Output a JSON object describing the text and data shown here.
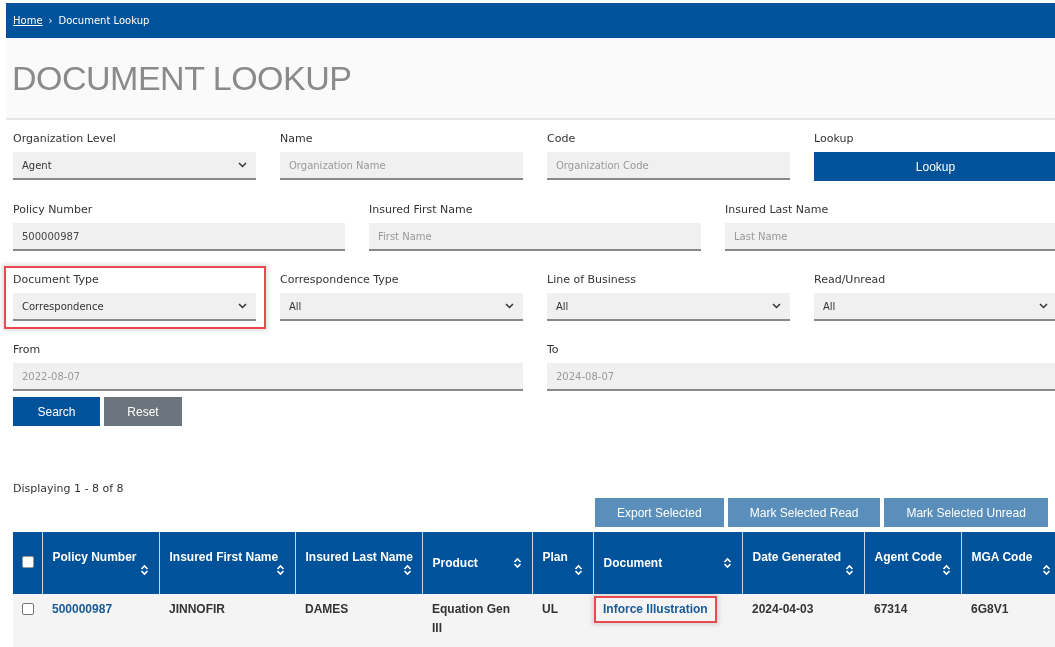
{
  "breadcrumb": [
    {
      "label": "Home",
      "link": true
    },
    {
      "label": "Document Lookup",
      "link": false
    }
  ],
  "breadcrumb_separator": "›",
  "page_title": "DOCUMENT LOOKUP",
  "form_rows": [
    [
      {
        "kind": "select",
        "label": "Organization Level",
        "value": "Agent",
        "highlighted": false
      },
      {
        "kind": "text",
        "label": "Name",
        "placeholder": "Organization Name"
      },
      {
        "kind": "text",
        "label": "Code",
        "placeholder": "Organization Code"
      },
      {
        "kind": "button",
        "label": "Lookup",
        "button": "Lookup"
      }
    ],
    [
      {
        "kind": "text",
        "label": "Policy Number",
        "value": "500000987"
      },
      {
        "kind": "text",
        "label": "Insured First Name",
        "placeholder": "First Name"
      },
      {
        "kind": "text",
        "label": "Insured Last Name",
        "placeholder": "Last Name"
      }
    ],
    [
      {
        "kind": "select",
        "label": "Document Type",
        "value": "Correspondence",
        "highlighted": true
      },
      {
        "kind": "select",
        "label": "Correspondence Type",
        "value": "All",
        "highlighted": false
      },
      {
        "kind": "select",
        "label": "Line of Business",
        "value": "All",
        "highlighted": false
      },
      {
        "kind": "select",
        "label": "Read/Unread",
        "value": "All",
        "highlighted": false
      }
    ],
    [
      {
        "kind": "text",
        "label": "From",
        "placeholder": "2022-08-07"
      },
      {
        "kind": "text",
        "label": "To",
        "placeholder": "2024-08-07"
      }
    ]
  ],
  "form_buttons": [
    {
      "label": "Search",
      "kind": "primary"
    },
    {
      "label": "Reset",
      "kind": "secondary"
    }
  ],
  "result_count": "Displaying 1 - 8 of 8",
  "table_actions": [
    "Export Selected",
    "Mark Selected Read",
    "Mark Selected Unread"
  ],
  "table": {
    "all_checked": false,
    "columns": [
      {
        "label": "Policy Number",
        "sort_below": true
      },
      {
        "label": "Insured First Name",
        "sort_below": true
      },
      {
        "label": "Insured Last Name",
        "sort_below": true
      },
      {
        "label": "Product",
        "sort_below": false
      },
      {
        "label": "Plan",
        "sort_below": true
      },
      {
        "label": "Document",
        "sort_below": false
      },
      {
        "label": "Date Generated",
        "sort_below": true
      },
      {
        "label": "Agent Code",
        "sort_below": true
      },
      {
        "label": "MGA Code",
        "sort_below": true
      }
    ],
    "rows": [
      {
        "checked": false,
        "cells": [
          {
            "text": "500000987",
            "kind": "link",
            "highlighted": false
          },
          {
            "text": "JINNOFIR",
            "kind": "text",
            "highlighted": false
          },
          {
            "text": "DAMES",
            "kind": "text",
            "highlighted": false
          },
          {
            "text": "Equation Gen III",
            "kind": "text",
            "highlighted": false
          },
          {
            "text": "UL",
            "kind": "text",
            "highlighted": false
          },
          {
            "text": "Inforce Illustration",
            "kind": "link",
            "highlighted": true
          },
          {
            "text": "2024-04-03",
            "kind": "text",
            "highlighted": false
          },
          {
            "text": "67314",
            "kind": "text",
            "highlighted": false
          },
          {
            "text": "6G8V1",
            "kind": "text",
            "highlighted": false
          }
        ]
      }
    ]
  }
}
